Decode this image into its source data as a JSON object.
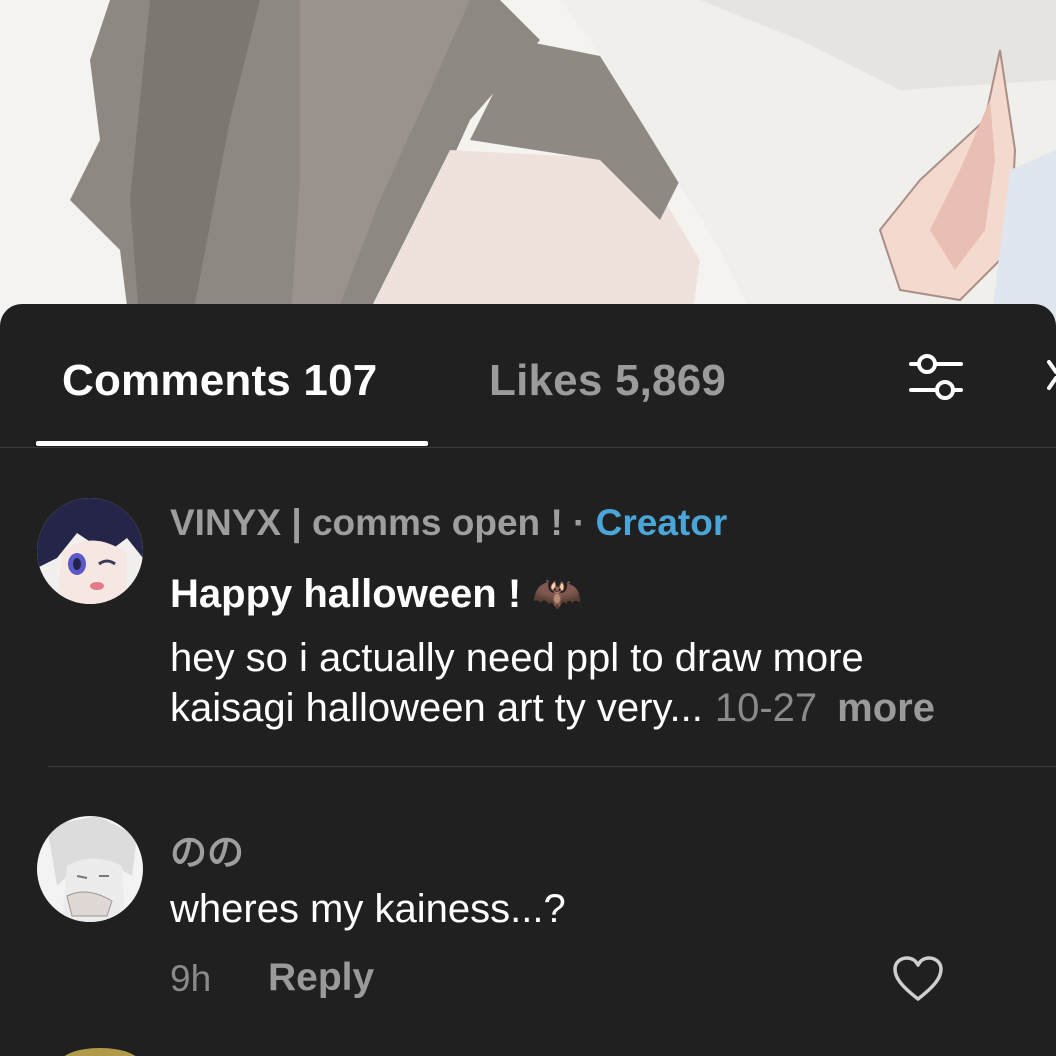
{
  "tabs": {
    "comments_label": "Comments 107",
    "likes_label": "Likes 5,869"
  },
  "comments": [
    {
      "username": "VINYX | comms open ! · ",
      "badge": "Creator",
      "title": "Happy halloween ! 🦇",
      "body_line1": "hey so i actually need ppl to draw more",
      "body_line2": "kaisagi halloween art ty very...",
      "date": "10-27",
      "more_label": "more"
    },
    {
      "username": "のの",
      "body": "wheres my kainess...?",
      "time": "9h",
      "reply_label": "Reply"
    }
  ],
  "icons": {
    "filter": "sliders-icon",
    "close": "close-icon",
    "like": "heart-icon"
  },
  "colors": {
    "sheet_bg": "#202020",
    "creator_badge": "#4aa6d8",
    "muted_text": "#9e9e9e"
  }
}
